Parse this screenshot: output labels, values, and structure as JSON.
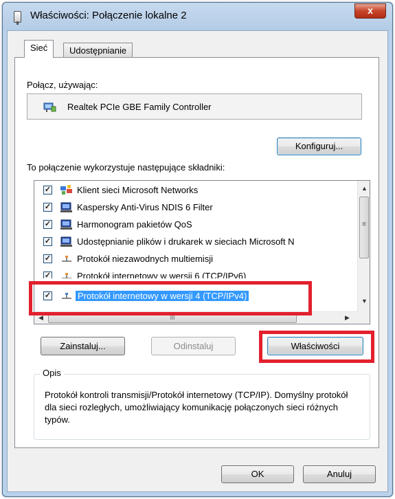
{
  "window": {
    "title": "Właściwości: Połączenie lokalne 2",
    "close_label": "x"
  },
  "tabs": [
    {
      "label": "Sieć",
      "active": true
    },
    {
      "label": "Udostępnianie",
      "active": false
    }
  ],
  "connect_using": {
    "label": "Połącz, używając:",
    "adapter": "Realtek PCIe GBE Family Controller",
    "configure_button": "Konfiguruj..."
  },
  "components": {
    "label": "To połączenie wykorzystuje następujące składniki:",
    "items": [
      {
        "label": "Klient sieci Microsoft Networks",
        "checked": true,
        "icon": "network-client-icon"
      },
      {
        "label": "Kaspersky Anti-Virus NDIS 6 Filter",
        "checked": true,
        "icon": "service-icon"
      },
      {
        "label": "Harmonogram pakietów QoS",
        "checked": true,
        "icon": "service-icon"
      },
      {
        "label": "Udostępnianie plików i drukarek w sieciach Microsoft N",
        "checked": true,
        "icon": "service-icon"
      },
      {
        "label": "Protokół niezawodnych multiemisji",
        "checked": true,
        "icon": "protocol-icon"
      },
      {
        "label": "Protokół internetowy w wersji 6 (TCP/IPv6)",
        "checked": true,
        "icon": "protocol-icon"
      },
      {
        "label": "Protokół internetowy w wersji 4 (TCP/IPv4)",
        "checked": true,
        "icon": "protocol-icon",
        "selected": true
      }
    ],
    "scroll_thumb_glyph": "≡",
    "hscroll_thumb_glyph": "III"
  },
  "buttons": {
    "install": "Zainstaluj...",
    "uninstall": "Odinstaluj",
    "properties": "Właściwości",
    "ok": "OK",
    "cancel": "Anuluj"
  },
  "description": {
    "legend": "Opis",
    "text": "Protokół kontroli transmisji/Protokół internetowy (TCP/IP). Domyślny protokół dla sieci rozległych, umożliwiający komunikację połączonych sieci różnych typów."
  },
  "colors": {
    "highlight_box": "#e3202d",
    "selection": "#3399ff"
  }
}
